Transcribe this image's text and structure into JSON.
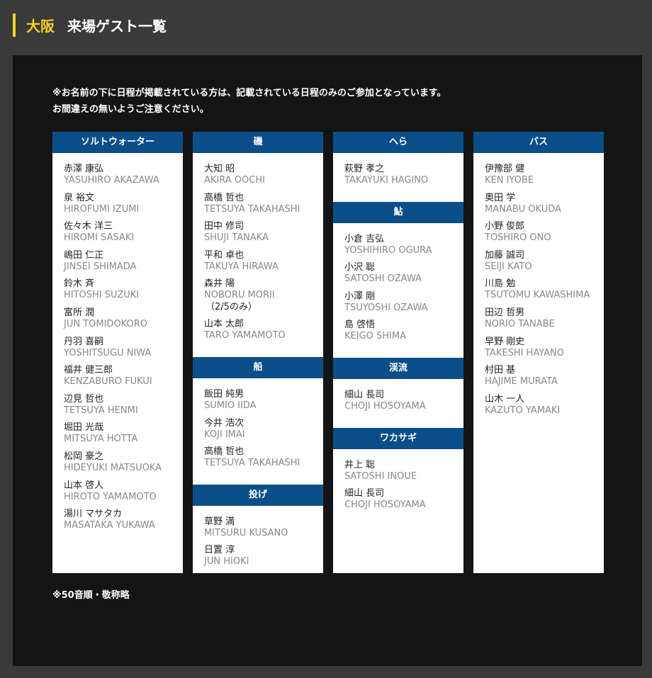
{
  "header": {
    "city": "大阪",
    "title": "来場ゲスト一覧"
  },
  "notice": {
    "line1": "※お名前の下に日程が掲載されている方は、記載されている日程のみのご参加となっています。",
    "line2": "お間違えの無いようご注意ください。"
  },
  "columns": [
    {
      "sections": [
        {
          "title": "ソルトウォーター",
          "guests": [
            {
              "jp": "赤澤 康弘",
              "en": "YASUHIRO AKAZAWA"
            },
            {
              "jp": "泉 裕文",
              "en": "HIROFUMI IZUMI"
            },
            {
              "jp": "佐々木 洋三",
              "en": "HIROMI SASAKI"
            },
            {
              "jp": "嶋田 仁正",
              "en": "JINSEI SHIMADA"
            },
            {
              "jp": "鈴木 斉",
              "en": "HITOSHI SUZUKI"
            },
            {
              "jp": "富所 潤",
              "en": "JUN TOMIDOKORO"
            },
            {
              "jp": "丹羽 喜嗣",
              "en": "YOSHITSUGU NIWA"
            },
            {
              "jp": "福井 健三郎",
              "en": "KENZABURO FUKUI"
            },
            {
              "jp": "辺見 哲也",
              "en": "TETSUYA HENMI"
            },
            {
              "jp": "堀田 光哉",
              "en": "MITSUYA HOTTA"
            },
            {
              "jp": "松岡 豪之",
              "en": "HIDEYUKI MATSUOKA"
            },
            {
              "jp": "山本 啓人",
              "en": "HIROTO YAMAMOTO"
            },
            {
              "jp": "湯川 マサタカ",
              "en": "MASATAKA YUKAWA"
            }
          ]
        }
      ]
    },
    {
      "sections": [
        {
          "title": "磯",
          "guests": [
            {
              "jp": "大知 昭",
              "en": "AKIRA OOCHI"
            },
            {
              "jp": "高橋 哲也",
              "en": "TETSUYA TAKAHASHI"
            },
            {
              "jp": "田中 修司",
              "en": "SHUJI TANAKA"
            },
            {
              "jp": "平和 卓也",
              "en": "TAKUYA HIRAWA"
            },
            {
              "jp": "森井 陽",
              "en": "NOBORU MORII",
              "note": "（2/5のみ）"
            },
            {
              "jp": "山本 太郎",
              "en": "TARO YAMAMOTO"
            }
          ]
        },
        {
          "title": "船",
          "guests": [
            {
              "jp": "飯田 純男",
              "en": "SUMIO IIDA"
            },
            {
              "jp": "今井 浩次",
              "en": "KOJI IMAI"
            },
            {
              "jp": "高橋 哲也",
              "en": "TETSUYA TAKAHASHI"
            }
          ]
        },
        {
          "title": "投げ",
          "guests": [
            {
              "jp": "草野 満",
              "en": "MITSURU KUSANO"
            },
            {
              "jp": "日置 淳",
              "en": "JUN HIOKI"
            }
          ]
        }
      ]
    },
    {
      "sections": [
        {
          "title": "へら",
          "guests": [
            {
              "jp": "萩野 孝之",
              "en": "TAKAYUKI HAGINO"
            }
          ]
        },
        {
          "title": "鮎",
          "guests": [
            {
              "jp": "小倉 吉弘",
              "en": "YOSHIHIRO OGURA"
            },
            {
              "jp": "小沢 聡",
              "en": "SATOSHI OZAWA"
            },
            {
              "jp": "小澤 剛",
              "en": "TSUYOSHI OZAWA"
            },
            {
              "jp": "島 啓悟",
              "en": "KEIGO SHIMA"
            }
          ]
        },
        {
          "title": "渓流",
          "guests": [
            {
              "jp": "細山 長司",
              "en": "CHOJI HOSOYAMA"
            }
          ]
        },
        {
          "title": "ワカサギ",
          "guests": [
            {
              "jp": "井上 聡",
              "en": "SATOSHI INOUE"
            },
            {
              "jp": "細山 長司",
              "en": "CHOJI HOSOYAMA"
            }
          ]
        }
      ]
    },
    {
      "sections": [
        {
          "title": "バス",
          "guests": [
            {
              "jp": "伊豫部 健",
              "en": "KEN IYOBE"
            },
            {
              "jp": "奥田 学",
              "en": "MANABU OKUDA"
            },
            {
              "jp": "小野 俊郎",
              "en": "TOSHIRO ONO"
            },
            {
              "jp": "加藤 誠司",
              "en": "SEIJI KATO"
            },
            {
              "jp": "川島 勉",
              "en": "TSUTOMU KAWASHIMA"
            },
            {
              "jp": "田辺 哲男",
              "en": "NORIO TANABE"
            },
            {
              "jp": "早野 剛史",
              "en": "TAKESHI HAYANO"
            },
            {
              "jp": "村田 基",
              "en": "HAJIME MURATA"
            },
            {
              "jp": "山木 一人",
              "en": "KAZUTO YAMAKI"
            }
          ]
        }
      ]
    }
  ],
  "footnote": "※50音順・敬称略",
  "colors": {
    "accent": "#f2d41c",
    "category_header": "#0b4f8a",
    "panel": "#141414",
    "page": "#3a3a3a"
  }
}
